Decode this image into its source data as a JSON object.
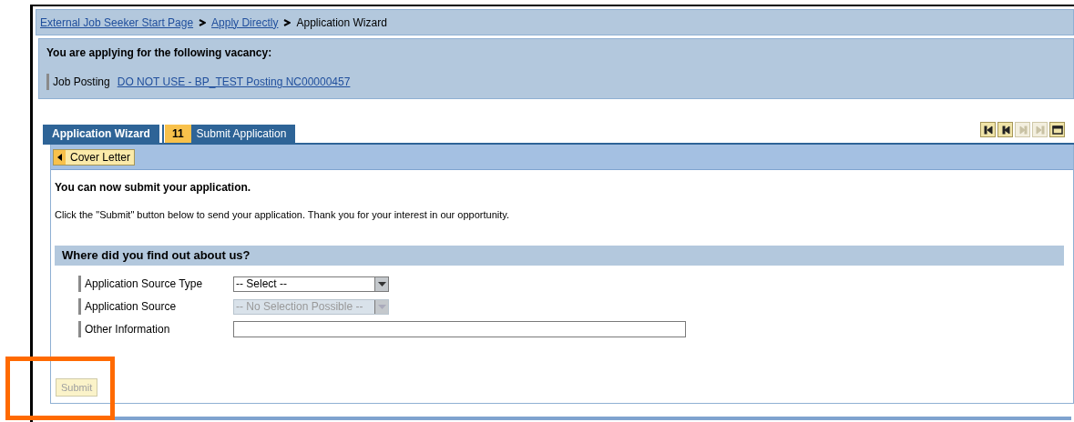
{
  "breadcrumb": [
    {
      "label": "External Job Seeker Start Page",
      "link": true
    },
    {
      "label": "Apply Directly",
      "link": true
    },
    {
      "label": "Application Wizard",
      "link": false
    }
  ],
  "vacancy": {
    "heading": "You are applying for the following vacancy:",
    "label": "Job Posting",
    "posting": "DO NOT USE - BP_TEST Posting NC00000457"
  },
  "tabs": [
    {
      "label": "Application Wizard",
      "selected": true
    },
    {
      "step": "11",
      "label": "Submit Application",
      "selected": false
    }
  ],
  "nav_buttons": [
    {
      "kind": "first",
      "disabled": false
    },
    {
      "kind": "previous",
      "disabled": false
    },
    {
      "kind": "next",
      "disabled": true
    },
    {
      "kind": "last",
      "disabled": true
    },
    {
      "kind": "window",
      "disabled": false
    }
  ],
  "back_button": "Cover Letter",
  "title": "You can now submit your application.",
  "message": "Click the \"Submit\" button below to send your application. Thank you for your interest in our opportunity.",
  "section": {
    "title": "Where did you find out about us?",
    "fields": [
      {
        "label": "Application Source Type",
        "kind": "select",
        "value": "-- Select --",
        "disabled": false
      },
      {
        "label": "Application Source",
        "kind": "select",
        "value": "-- No Selection Possible --",
        "disabled": true
      },
      {
        "label": "Other Information",
        "kind": "text",
        "disabled": false
      }
    ]
  },
  "submit": {
    "label": "Submit",
    "disabled": true
  }
}
